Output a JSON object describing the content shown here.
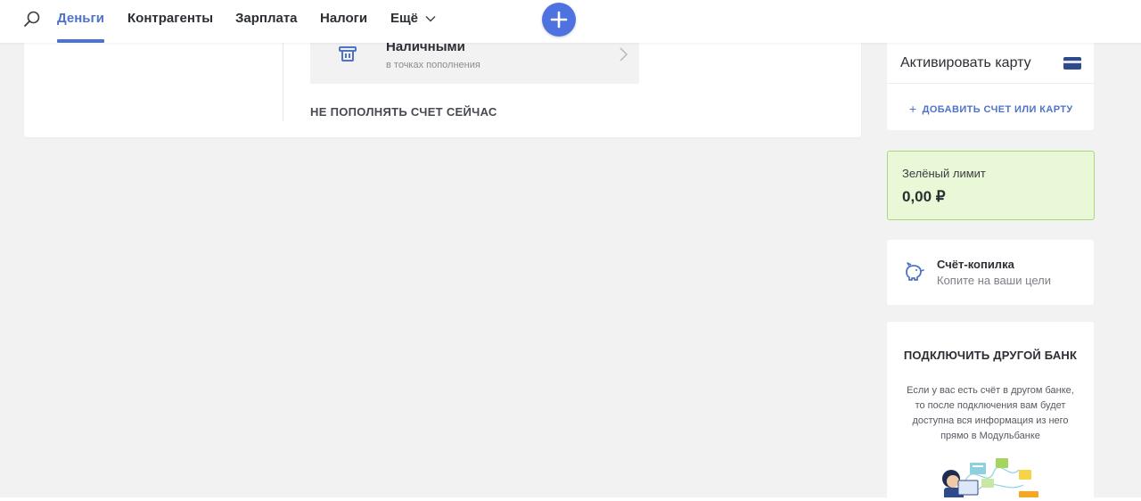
{
  "nav": {
    "items": [
      {
        "label": "Деньги",
        "active": true
      },
      {
        "label": "Контрагенты"
      },
      {
        "label": "Зарплата"
      },
      {
        "label": "Налоги"
      },
      {
        "label": "Ещё"
      }
    ],
    "accent_color": "#4e73c9"
  },
  "topup": {
    "cash_title": "Наличными",
    "cash_subtitle": "в точках пополнения",
    "skip_label": "НЕ ПОПОЛНЯТЬ СЧЕТ СЕЙЧАС"
  },
  "cards": {
    "activate_label": "Активировать карту",
    "add_label": "ДОБАВИТЬ СЧЕТ ИЛИ КАРТУ"
  },
  "green_limit": {
    "title": "Зелёный лимит",
    "value": "0,00 ₽",
    "background": "#e9f8d6",
    "border": "#a9d97a"
  },
  "piggy": {
    "title": "Счёт-копилка",
    "subtitle": "Копите на ваши цели"
  },
  "other_bank": {
    "title": "ПОДКЛЮЧИТЬ ДРУГОЙ БАНК",
    "desc_lines": [
      "Если у вас есть счёт в другом банке,",
      "то после подключения вам будет",
      "доступна вся информация из него",
      "прямо в Модульбанке"
    ]
  }
}
